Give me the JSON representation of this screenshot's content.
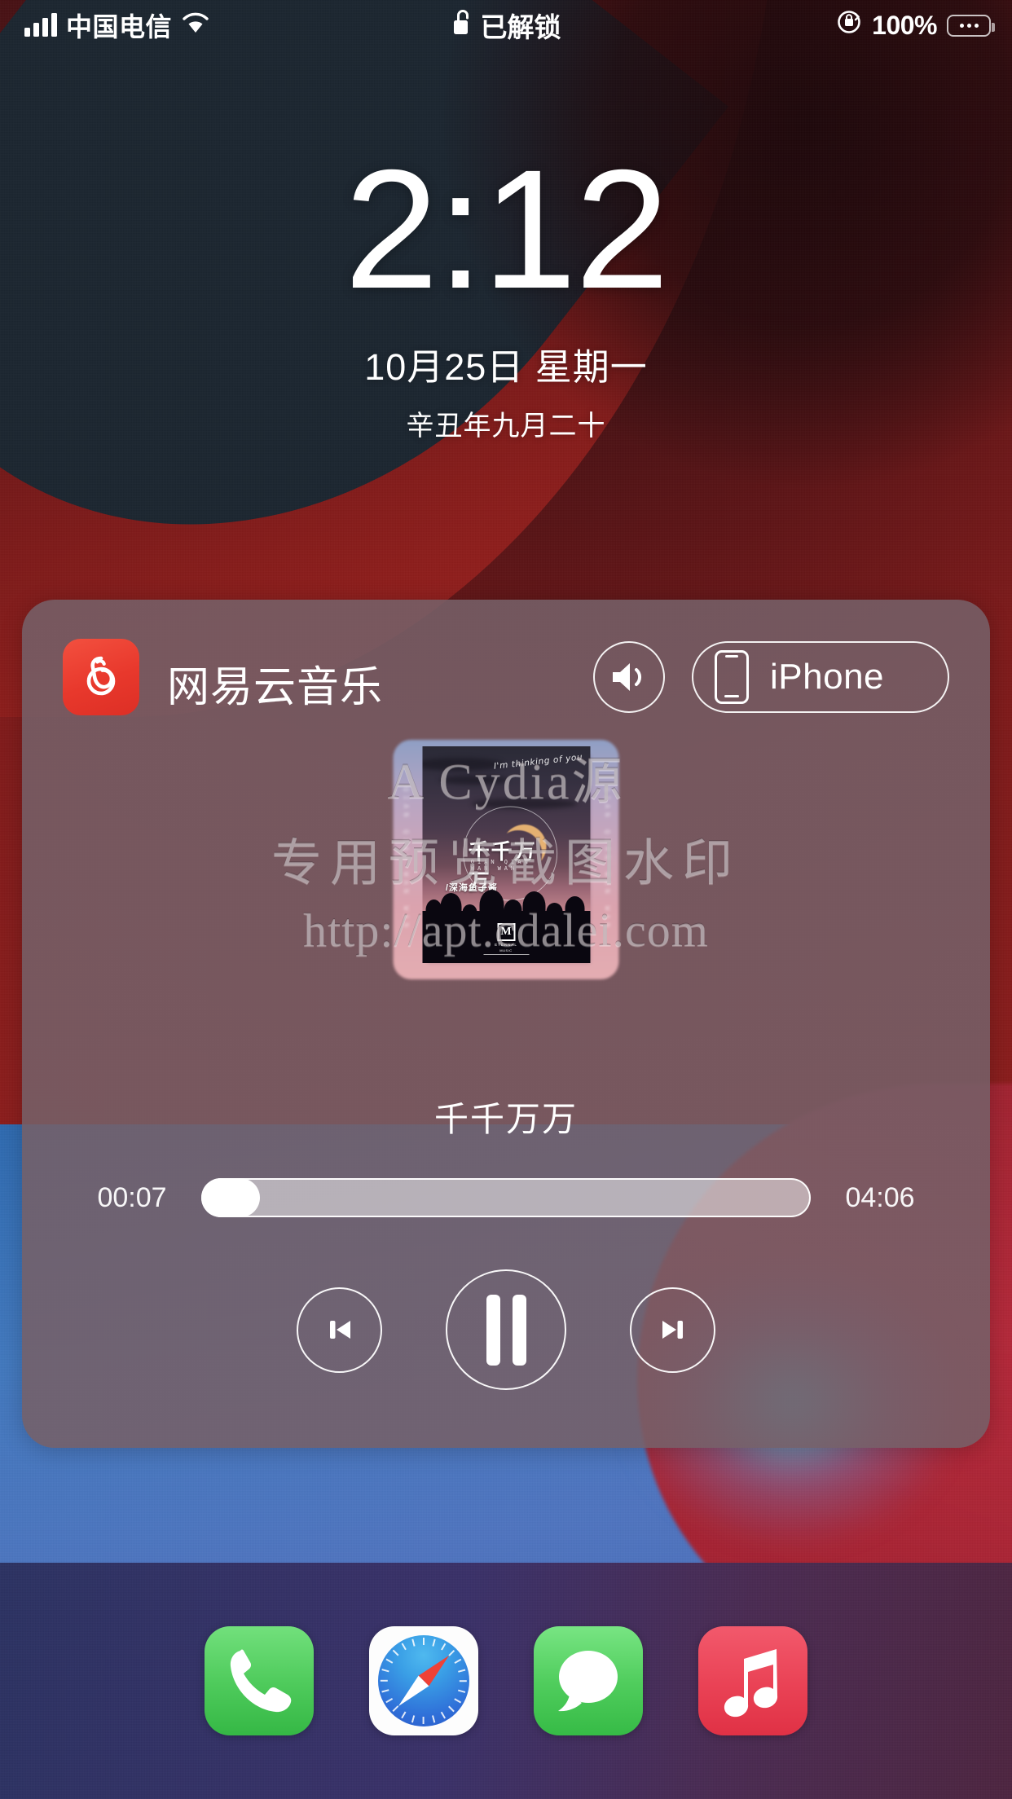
{
  "statusbar": {
    "signal_icon": "cellular-bars-icon",
    "carrier": "中国电信",
    "wifi_icon": "wifi-icon",
    "lock_icon": "unlocked-lock-icon",
    "lock_text": "已解锁",
    "rotation_icon": "rotation-lock-icon",
    "battery_percent": "100%",
    "battery_icon": "battery-full-icon"
  },
  "lockscreen": {
    "time": "2:12",
    "date": "10月25日 星期一",
    "lunar_date": "辛丑年九月二十"
  },
  "now_playing": {
    "app_icon": "netease-cloud-music-icon",
    "app_name": "网易云音乐",
    "volume_icon": "speaker-wave-icon",
    "route": {
      "icon": "iphone-device-icon",
      "label": "iPhone"
    },
    "artwork": {
      "handwritten_text": "I'm thinking of you",
      "title_overlay": "千千万万",
      "pinyin_overlay": "QIAN QIAN WAN WAN",
      "artist_overlay": "/深海鱼子酱",
      "label_mark": "M",
      "label_name": "ETERNAL",
      "label_sub": "MUSIC",
      "side_text_left": "QIAN QIAN WAN WAN",
      "side_text_right": "QIAN QIAN WAN WAN"
    },
    "song_title": "千千万万",
    "elapsed_time": "00:07",
    "total_time": "04:06",
    "progress_percent": 3,
    "controls": {
      "previous_icon": "skip-backward-icon",
      "pause_icon": "pause-icon",
      "next_icon": "skip-forward-icon"
    }
  },
  "watermark": {
    "line1": "A Cydia源",
    "line2": "专用预览截图水印",
    "line3": "http://apt.cdalei.com"
  },
  "dock": {
    "items": [
      {
        "name": "phone-app-icon"
      },
      {
        "name": "safari-app-icon"
      },
      {
        "name": "messages-app-icon"
      },
      {
        "name": "music-app-icon"
      }
    ]
  },
  "colors": {
    "wallpaper_red": "#8e1d1c",
    "wallpaper_navy": "#1b2530",
    "wallpaper_blue": "#4f74bf",
    "dock_band": "#3a3168",
    "widget_bg": "#756068",
    "netease_red": "#e8382c",
    "music_app_red": "#ea4356",
    "phone_green": "#4fcb5c"
  }
}
